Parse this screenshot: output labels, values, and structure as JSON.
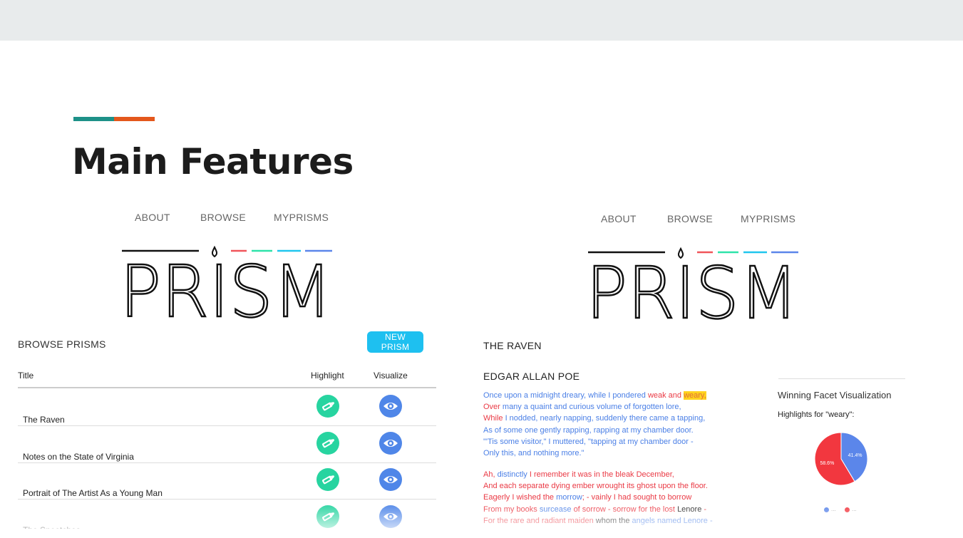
{
  "slide": {
    "title": "Main Features",
    "accent_colors": [
      "#1d9188",
      "#e4571c"
    ]
  },
  "nav": {
    "items": [
      "ABOUT",
      "BROWSE",
      "MYPRISMS"
    ]
  },
  "logo": {
    "text": "PRISM",
    "stripe_colors": [
      "#f0555a",
      "#2ee3a9",
      "#20c6ee",
      "#5b86ea"
    ]
  },
  "browse": {
    "heading": "BROWSE PRISMS",
    "new_button": "NEW PRISM",
    "columns": {
      "title": "Title",
      "highlight": "Highlight",
      "visualize": "Visualize"
    },
    "rows": [
      {
        "title": "The Raven"
      },
      {
        "title": "Notes on the State of Virginia"
      },
      {
        "title": "Portrait of The Artist As a Young Man"
      },
      {
        "title": "The Sneetches"
      }
    ],
    "icons": {
      "highlight": "highlighter-icon",
      "visualize": "eye-icon"
    }
  },
  "prism": {
    "title": "THE RAVEN",
    "author": "EDGAR ALLAN POE",
    "stanza1": [
      [
        [
          "b",
          "Once upon a midnight dreary, while I pondered "
        ],
        [
          "r",
          "weak and "
        ],
        [
          "hi",
          "weary,"
        ]
      ],
      [
        [
          "r",
          "Over "
        ],
        [
          "b",
          "many a quaint and curious volume of forgotten lore,"
        ]
      ],
      [
        [
          "r",
          "While "
        ],
        [
          "b",
          "I nodded, nearly napping, suddenly there came a tapping,"
        ]
      ],
      [
        [
          "b",
          "As of some one gently rapping, rapping at my chamber door."
        ]
      ],
      [
        [
          "b",
          "\"'Tis some visitor,\" I muttered, \"tapping at my chamber door -"
        ]
      ],
      [
        [
          "b",
          "Only this, and nothing more.\""
        ]
      ]
    ],
    "stanza2": [
      [
        [
          "r",
          "Ah, "
        ],
        [
          "b",
          "distinctly "
        ],
        [
          "r",
          "I remember it was in the bleak December,"
        ]
      ],
      [
        [
          "r",
          "And each separate dying ember wrought its ghost upon the floor."
        ]
      ],
      [
        [
          "r",
          "Eagerly I wished the "
        ],
        [
          "b",
          "morrow"
        ],
        [
          "r",
          "; - vainly I had sought to borrow"
        ]
      ],
      [
        [
          "r",
          "From my books "
        ],
        [
          "b",
          "surcease "
        ],
        [
          "r",
          "of sorrow - sorrow for the lost "
        ],
        [
          "k",
          "Lenore"
        ],
        [
          "r",
          " -"
        ]
      ],
      [
        [
          "r",
          "For the rare and radiant maiden "
        ],
        [
          "k",
          "whom the "
        ],
        [
          "b",
          "angels named Lenore -"
        ]
      ]
    ],
    "visualization": {
      "title": "Winning Facet Visualization",
      "subtitle": "Highlights for \"weary\":",
      "legend": [
        "...",
        "..."
      ]
    }
  },
  "chart_data": {
    "type": "pie",
    "title": "",
    "slices": [
      {
        "label": "41.4%",
        "value": 41.4,
        "color": "#5b86ea"
      },
      {
        "label": "58.6%",
        "value": 58.6,
        "color": "#f2373f"
      }
    ]
  }
}
